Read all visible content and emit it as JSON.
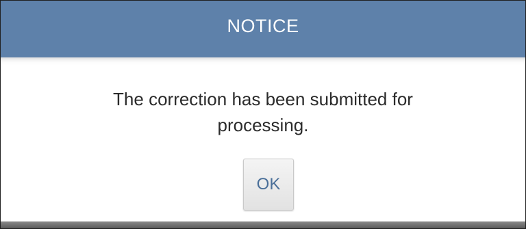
{
  "dialog": {
    "title": "NOTICE",
    "message_line1": "The correction has been submitted for",
    "message_line2": "processing.",
    "ok_label": "OK"
  },
  "colors": {
    "titlebar": "#5e81aa",
    "title_text": "#ffffff",
    "message_text": "#2b2b2b",
    "ok_text": "#4a6f99"
  }
}
